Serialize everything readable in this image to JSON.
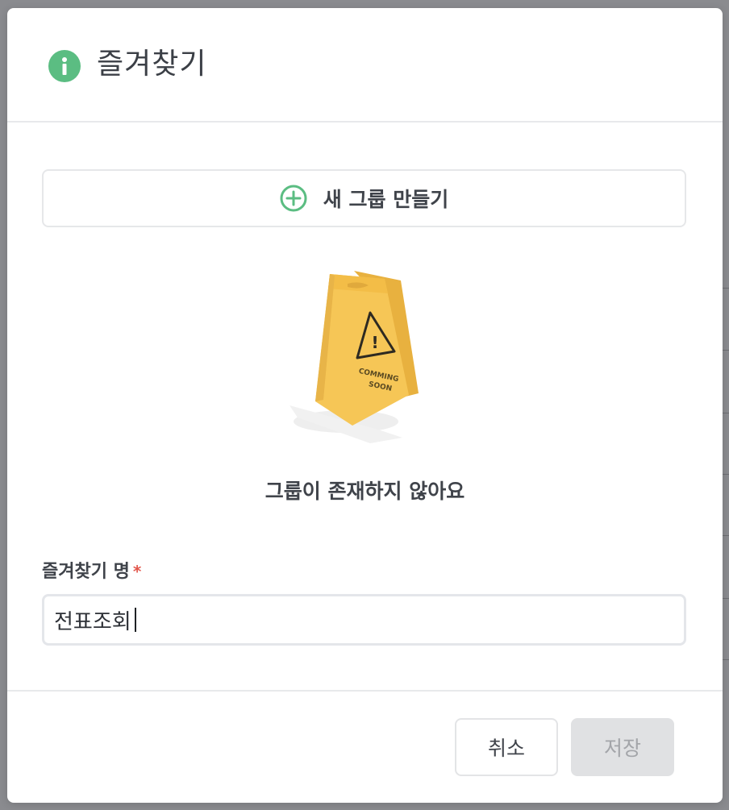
{
  "dialog": {
    "title": "즐겨찾기",
    "title_icon": "info-icon",
    "accent_color": "#5bbd82"
  },
  "new_group": {
    "label": "새 그룹 만들기",
    "icon": "plus-circle-icon"
  },
  "empty_state": {
    "illustration": "coming-soon-sign",
    "sign_text": [
      "COMMING",
      "SOON"
    ],
    "message": "그룹이 존재하지 않아요"
  },
  "form": {
    "name_label": "즐겨찾기 명",
    "required_mark": "*",
    "name_value": "전표조회"
  },
  "footer": {
    "cancel_label": "취소",
    "save_label": "저장",
    "save_disabled": true
  }
}
